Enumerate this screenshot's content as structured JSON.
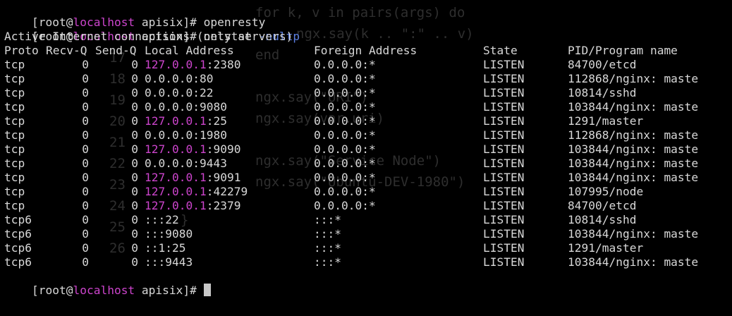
{
  "terminal": {
    "background": "#000000",
    "foreground": "#d8d8d8",
    "accent_host": "#cc44cc",
    "accent_arg": "#5a7ee0",
    "prompt": {
      "open": "[root@",
      "host": "localhost",
      "close": " apisix]# "
    },
    "cmd1": "openresty",
    "cmd2": "netstat",
    "cmd2_arg": "-nultp",
    "intro": "Active Internet connections (only servers)",
    "headers": {
      "proto": "Proto",
      "recvq": "Recv-Q",
      "sendq": "Send-Q",
      "local": "Local Address",
      "foreign": "Foreign Address",
      "state": "State",
      "pid": "PID/Program name"
    },
    "rows": [
      {
        "proto": "tcp",
        "recvq": "0",
        "sendq": "0",
        "local_hl": "127.0.0.1",
        "local_rest": ":2380",
        "foreign": "0.0.0.0:*",
        "state": "LISTEN",
        "pid": "84700/etcd"
      },
      {
        "proto": "tcp",
        "recvq": "0",
        "sendq": "0",
        "local_hl": "",
        "local_rest": "0.0.0.0:80",
        "foreign": "0.0.0.0:*",
        "state": "LISTEN",
        "pid": "112868/nginx: maste"
      },
      {
        "proto": "tcp",
        "recvq": "0",
        "sendq": "0",
        "local_hl": "",
        "local_rest": "0.0.0.0:22",
        "foreign": "0.0.0.0:*",
        "state": "LISTEN",
        "pid": "10814/sshd"
      },
      {
        "proto": "tcp",
        "recvq": "0",
        "sendq": "0",
        "local_hl": "",
        "local_rest": "0.0.0.0:9080",
        "foreign": "0.0.0.0:*",
        "state": "LISTEN",
        "pid": "103844/nginx: maste"
      },
      {
        "proto": "tcp",
        "recvq": "0",
        "sendq": "0",
        "local_hl": "127.0.0.1",
        "local_rest": ":25",
        "foreign": "0.0.0.0:*",
        "state": "LISTEN",
        "pid": "1291/master"
      },
      {
        "proto": "tcp",
        "recvq": "0",
        "sendq": "0",
        "local_hl": "",
        "local_rest": "0.0.0.0:1980",
        "foreign": "0.0.0.0:*",
        "state": "LISTEN",
        "pid": "112868/nginx: maste"
      },
      {
        "proto": "tcp",
        "recvq": "0",
        "sendq": "0",
        "local_hl": "127.0.0.1",
        "local_rest": ":9090",
        "foreign": "0.0.0.0:*",
        "state": "LISTEN",
        "pid": "103844/nginx: maste"
      },
      {
        "proto": "tcp",
        "recvq": "0",
        "sendq": "0",
        "local_hl": "",
        "local_rest": "0.0.0.0:9443",
        "foreign": "0.0.0.0:*",
        "state": "LISTEN",
        "pid": "103844/nginx: maste"
      },
      {
        "proto": "tcp",
        "recvq": "0",
        "sendq": "0",
        "local_hl": "127.0.0.1",
        "local_rest": ":9091",
        "foreign": "0.0.0.0:*",
        "state": "LISTEN",
        "pid": "103844/nginx: maste"
      },
      {
        "proto": "tcp",
        "recvq": "0",
        "sendq": "0",
        "local_hl": "127.0.0.1",
        "local_rest": ":42279",
        "foreign": "0.0.0.0:*",
        "state": "LISTEN",
        "pid": "107995/node"
      },
      {
        "proto": "tcp",
        "recvq": "0",
        "sendq": "0",
        "local_hl": "127.0.0.1",
        "local_rest": ":2379",
        "foreign": "0.0.0.0:*",
        "state": "LISTEN",
        "pid": "84700/etcd"
      },
      {
        "proto": "tcp6",
        "recvq": "0",
        "sendq": "0",
        "local_hl": "",
        "local_rest": ":::22",
        "foreign": ":::*",
        "state": "LISTEN",
        "pid": "10814/sshd"
      },
      {
        "proto": "tcp6",
        "recvq": "0",
        "sendq": "0",
        "local_hl": "",
        "local_rest": ":::9080",
        "foreign": ":::*",
        "state": "LISTEN",
        "pid": "103844/nginx: maste"
      },
      {
        "proto": "tcp6",
        "recvq": "0",
        "sendq": "0",
        "local_hl": "",
        "local_rest": "::1:25",
        "foreign": ":::*",
        "state": "LISTEN",
        "pid": "1291/master"
      },
      {
        "proto": "tcp6",
        "recvq": "0",
        "sendq": "0",
        "local_hl": "",
        "local_rest": ":::9443",
        "foreign": ":::*",
        "state": "LISTEN",
        "pid": "103844/nginx: maste"
      }
    ],
    "ghost": {
      "line_numbers": [
        "17",
        "18",
        "19",
        "20",
        "21",
        "22",
        "23",
        "24",
        "25",
        "26"
      ],
      "code_lines": [
        "for k, v in pairs(args) do",
        "ngx.say(k .. \":\" .. v)",
        "end",
        "",
        "ngx.say(\"URI\")",
        "ngx.say(var.uri)",
        "",
        "ngx.say(\"Service Node\")",
        "ngx.say(\"Ubuntu-DEV-1980\")"
      ],
      "closing_brace": "}"
    }
  }
}
